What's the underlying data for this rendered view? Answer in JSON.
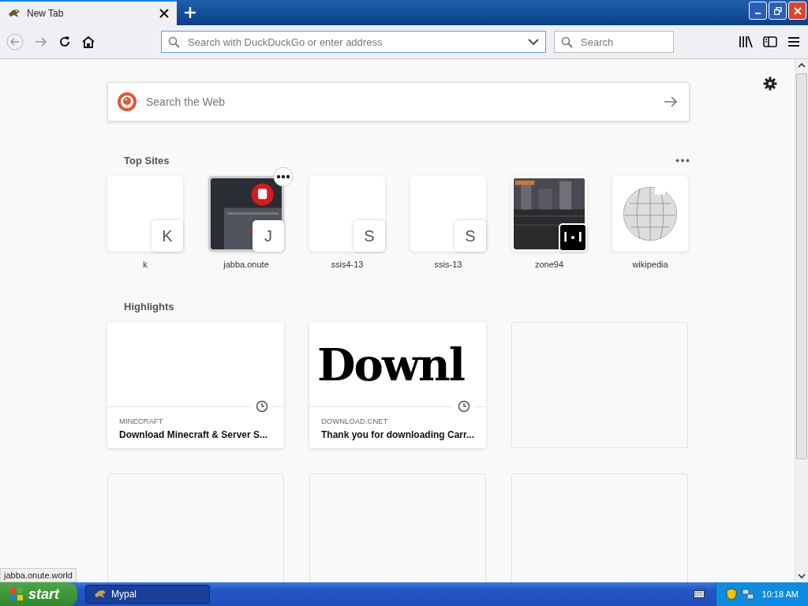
{
  "tab": {
    "title": "New Tab",
    "selected": true
  },
  "toolbar": {
    "address_placeholder": "Search with DuckDuckGo or enter address",
    "search_placeholder": "Search"
  },
  "web_search": {
    "placeholder": "Search the Web"
  },
  "top_sites": {
    "title": "Top Sites",
    "items": [
      {
        "label": "k",
        "letter": "K",
        "kind": "blank",
        "hovered": false
      },
      {
        "label": "jabba.onute",
        "letter": "J",
        "kind": "dark",
        "hovered": true
      },
      {
        "label": "ssis4-13",
        "letter": "S",
        "kind": "blank",
        "hovered": false
      },
      {
        "label": "ssis-13",
        "letter": "S",
        "kind": "blank",
        "hovered": false
      },
      {
        "label": "zone94",
        "kind": "city",
        "hovered": false
      },
      {
        "label": "wikipedia",
        "kind": "globe",
        "hovered": false
      }
    ]
  },
  "highlights": {
    "title": "Highlights",
    "items": [
      {
        "kind": "page",
        "source": "MINECRAFT",
        "title": "Download Minecraft & Server S..."
      },
      {
        "kind": "page",
        "source": "DOWNLOAD.CNET",
        "title": "Thank you for downloading Carr...",
        "thumb_text": "Downl"
      },
      {
        "kind": "empty"
      },
      {
        "kind": "empty"
      },
      {
        "kind": "empty"
      },
      {
        "kind": "empty"
      }
    ]
  },
  "status_url": "jabba.onute.world",
  "taskbar": {
    "start": "start",
    "task": "Mypal",
    "clock": "10:18 AM"
  }
}
